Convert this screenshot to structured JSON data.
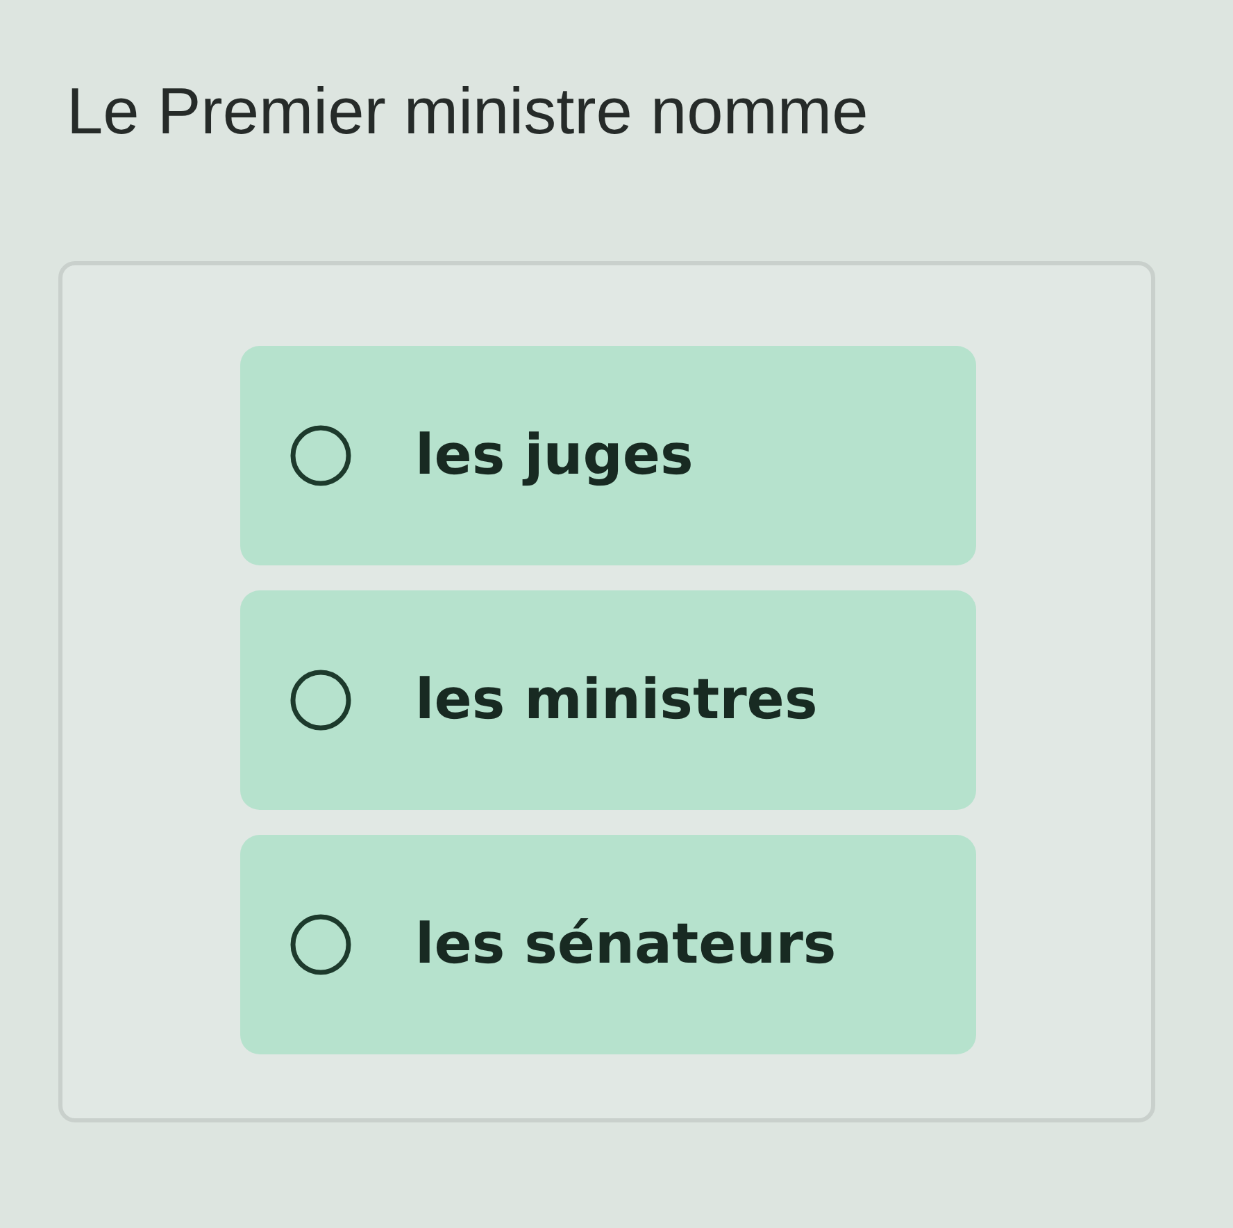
{
  "question": {
    "text": "Le Premier ministre nomme"
  },
  "options": [
    {
      "label": "les juges",
      "selected": false
    },
    {
      "label": "les ministres",
      "selected": false
    },
    {
      "label": "les sénateurs",
      "selected": false
    }
  ]
}
